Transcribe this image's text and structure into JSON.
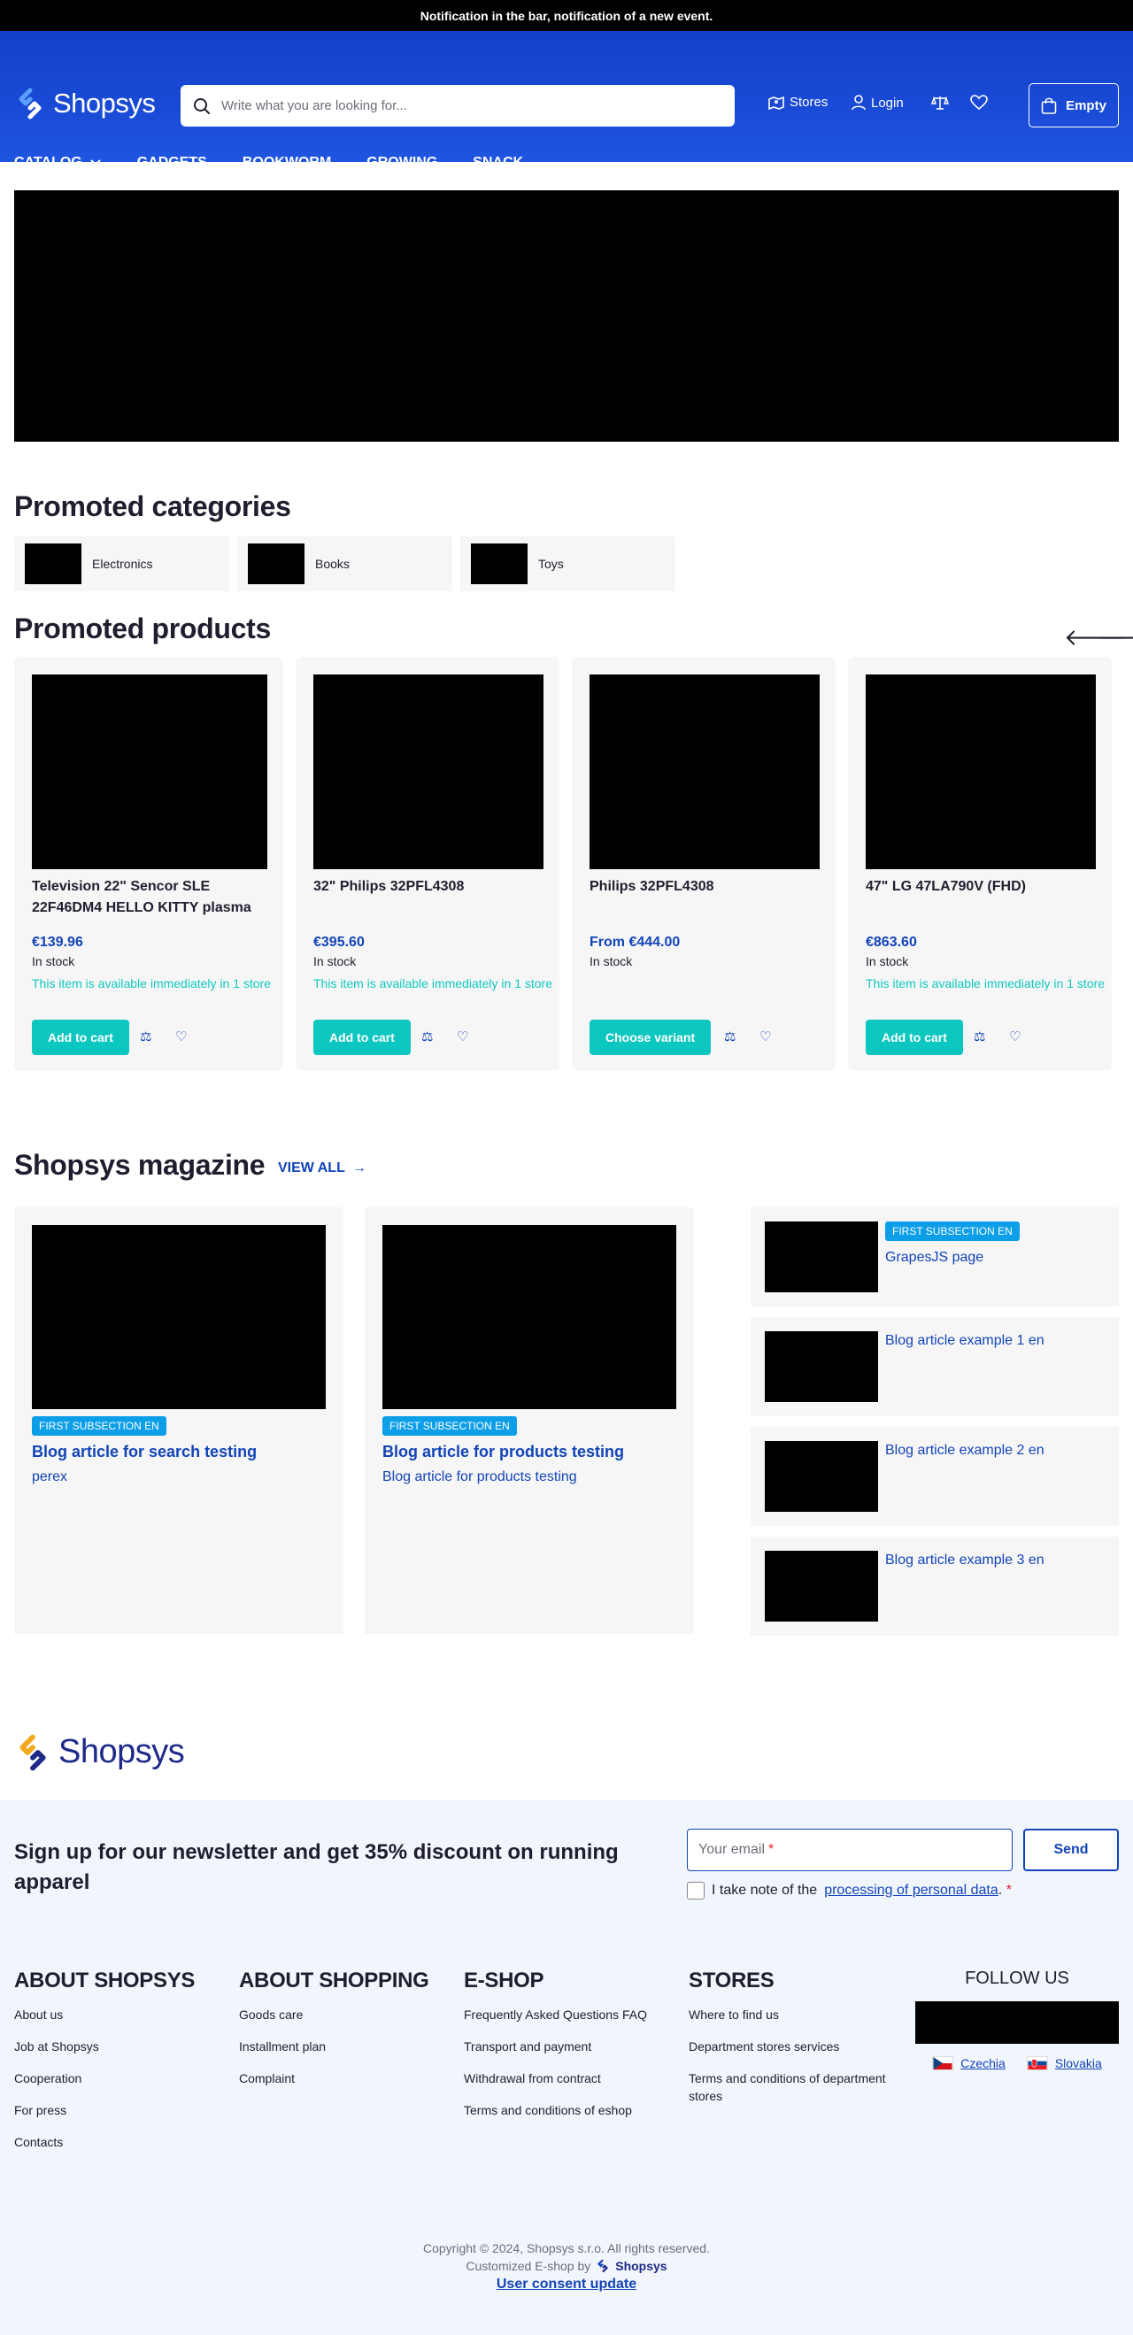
{
  "notification": "Notification in the bar, notification of a new event.",
  "header": {
    "logo": "Shopsys",
    "search_placeholder": "Write what you are looking for...",
    "stores": "Stores",
    "login": "Login",
    "cart": "Empty"
  },
  "menu": [
    "CATALOG",
    "GADGETS",
    "BOOKWORM",
    "GROWING",
    "SNACK"
  ],
  "promoted_categories": {
    "title": "Promoted categories",
    "items": [
      "Electronics",
      "Books",
      "Toys"
    ]
  },
  "promoted_products": {
    "title": "Promoted products",
    "items": [
      {
        "name": "Television 22\" Sencor SLE 22F46DM4 HELLO KITTY plasma",
        "price": "€139.96",
        "stock": "In stock",
        "availability": "This item is available immediately in 1 store",
        "button": "Add to cart"
      },
      {
        "name": "32\" Philips 32PFL4308",
        "price": "€395.60",
        "stock": "In stock",
        "availability": "This item is available immediately in 1 store",
        "button": "Add to cart"
      },
      {
        "name": "Philips 32PFL4308",
        "price": "From €444.00",
        "stock": "In stock",
        "availability": "",
        "button": "Choose variant"
      },
      {
        "name": "47\" LG 47LA790V (FHD)",
        "price": "€863.60",
        "stock": "In stock",
        "availability": "This item is available immediately in 1 store",
        "button": "Add to cart"
      }
    ]
  },
  "magazine": {
    "title": "Shopsys magazine",
    "view_all": "VIEW ALL",
    "main": [
      {
        "badge": "FIRST SUBSECTION EN",
        "title": "Blog article for search testing",
        "perex": "perex"
      },
      {
        "badge": "FIRST SUBSECTION EN",
        "title": "Blog article for products testing",
        "perex": "Blog article for products testing"
      }
    ],
    "side": [
      {
        "badge": "FIRST SUBSECTION EN",
        "title": "GrapesJS page"
      },
      {
        "badge": "",
        "title": "Blog article example 1 en"
      },
      {
        "badge": "",
        "title": "Blog article example 2 en"
      },
      {
        "badge": "",
        "title": "Blog article example 3 en"
      }
    ]
  },
  "footer": {
    "logo": "Shopsys",
    "newsletter_title": "Sign up for our newsletter and get 35% discount on running apparel",
    "email_placeholder": "Your email",
    "send": "Send",
    "consent_prefix": "I take note of the",
    "consent_link": "processing of personal data",
    "consent_suffix": ".",
    "columns": [
      {
        "title": "ABOUT SHOPSYS",
        "links": [
          "About us",
          "Job at Shopsys",
          "Cooperation",
          "For press",
          "Contacts"
        ]
      },
      {
        "title": "ABOUT SHOPPING",
        "links": [
          "Goods care",
          "Installment plan",
          "Complaint"
        ]
      },
      {
        "title": "E-SHOP",
        "links": [
          "Frequently Asked Questions FAQ",
          "Transport and payment",
          "Withdrawal from contract",
          "Terms and conditions of eshop"
        ]
      },
      {
        "title": "STORES",
        "links": [
          "Where to find us",
          "Department stores services",
          "Terms and conditions of department stores"
        ]
      }
    ],
    "follow_us": "FOLLOW US",
    "languages": [
      "Czechia",
      "Slovakia"
    ],
    "copyright": "Copyright © 2024, Shopsys s.r.o. All rights reserved.",
    "customized": "Customized E-shop by",
    "customized_logo": "Shopsys",
    "consent_update": "User consent update"
  },
  "colors": {
    "brand_blue": "#1a4bd6",
    "link_blue": "#1244b8",
    "accent_teal": "#0cc7bf",
    "badge_blue": "#0d9ee8"
  }
}
